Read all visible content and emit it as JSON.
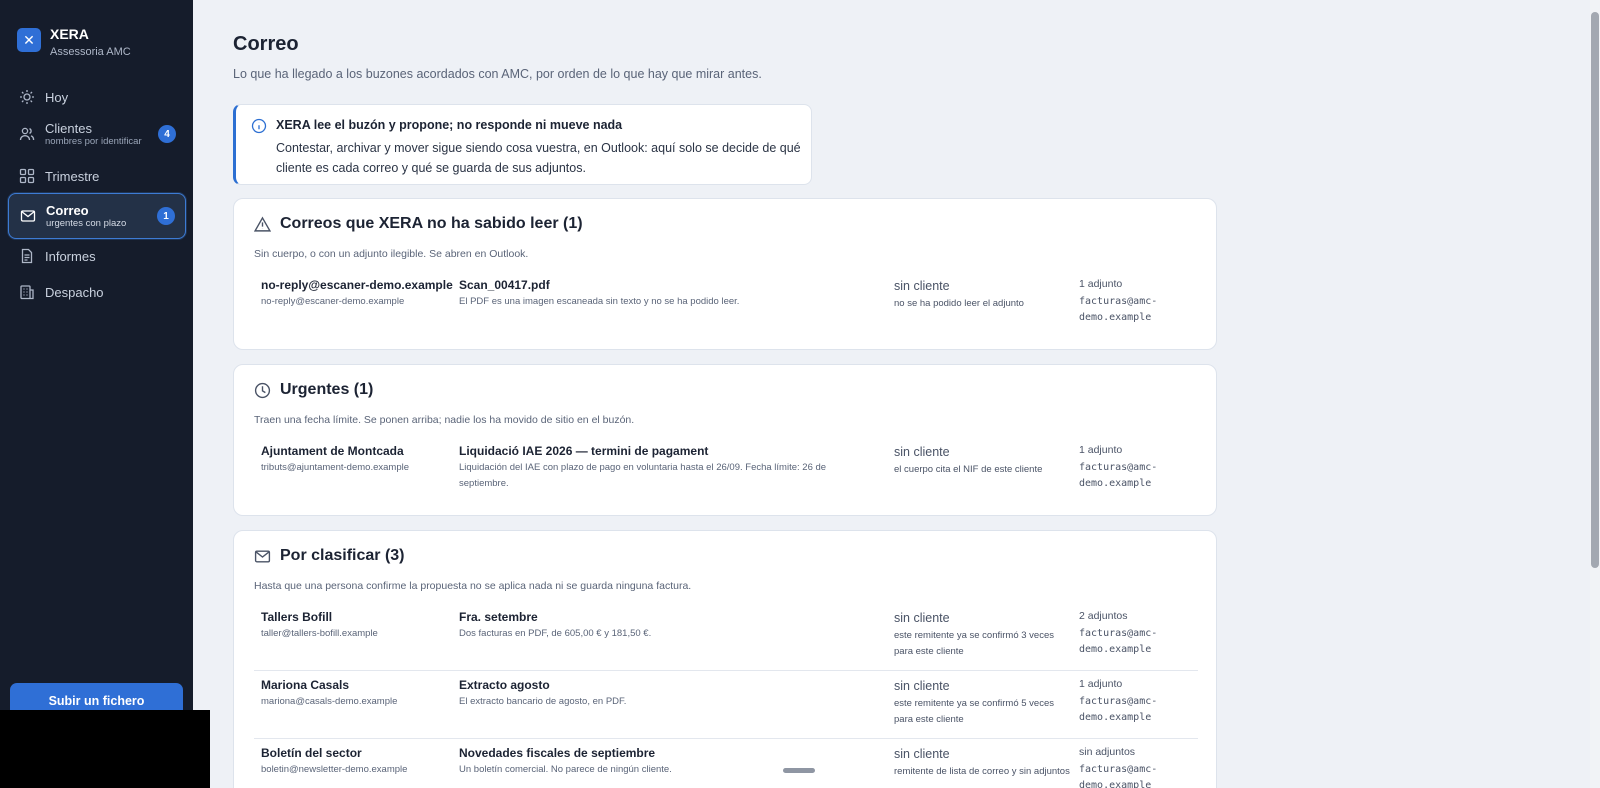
{
  "brand": {
    "name": "XERA",
    "subtitle": "Assessoria AMC",
    "logo_glyph": "✕"
  },
  "sidebar": {
    "items": [
      {
        "label": "Hoy",
        "sub": "",
        "badge": "",
        "icon": "sun-icon"
      },
      {
        "label": "Clientes",
        "sub": "nombres por identificar",
        "badge": "4",
        "icon": "users-icon"
      },
      {
        "label": "Trimestre",
        "sub": "",
        "badge": "",
        "icon": "grid-icon"
      },
      {
        "label": "Correo",
        "sub": "urgentes con plazo",
        "badge": "1",
        "icon": "mail-icon",
        "active": true
      },
      {
        "label": "Informes",
        "sub": "",
        "badge": "",
        "icon": "document-icon"
      },
      {
        "label": "Despacho",
        "sub": "",
        "badge": "",
        "icon": "building-icon"
      }
    ],
    "upload_label": "Subir un fichero"
  },
  "page": {
    "title": "Correo",
    "subtitle": "Lo que ha llegado a los buzones acordados con AMC, por orden de lo que hay que mirar antes."
  },
  "notice": {
    "title": "XERA lee el buzón y propone; no responde ni mueve nada",
    "body": "Contestar, archivar y mover sigue siendo cosa vuestra, en Outlook: aquí solo se decide de qué cliente es cada correo y qué se guarda de sus adjuntos."
  },
  "sections": [
    {
      "title": "Correos que XERA no ha sabido leer (1)",
      "subtitle": "Sin cuerpo, o con un adjunto ilegible. Se abren en Outlook.",
      "icon": "warning-icon",
      "rows": [
        {
          "from_name": "no-reply@escaner-demo.example",
          "from_email": "no-reply@escaner-demo.example",
          "subject": "Scan_00417.pdf",
          "description": "El PDF es una imagen escaneada sin texto y no se ha podido leer.",
          "client": "sin cliente",
          "reason": "no se ha podido leer el adjunto",
          "attachments": "1 adjunto",
          "mailbox_1": "facturas@amc-",
          "mailbox_2": "demo.example"
        }
      ]
    },
    {
      "title": "Urgentes (1)",
      "subtitle": "Traen una fecha límite. Se ponen arriba; nadie los ha movido de sitio en el buzón.",
      "icon": "clock-icon",
      "rows": [
        {
          "from_name": "Ajuntament de Montcada",
          "from_email": "tributs@ajuntament-demo.example",
          "subject": "Liquidació IAE 2026 — termini de pagament",
          "description": "Liquidación del IAE con plazo de pago en voluntaria hasta el 26/09. Fecha límite: 26 de septiembre.",
          "client": "sin cliente",
          "reason": "el cuerpo cita el NIF de este cliente",
          "attachments": "1 adjunto",
          "mailbox_1": "facturas@amc-",
          "mailbox_2": "demo.example"
        }
      ]
    },
    {
      "title": "Por clasificar (3)",
      "subtitle": "Hasta que una persona confirme la propuesta no se aplica nada ni se guarda ninguna factura.",
      "icon": "mail-icon",
      "rows": [
        {
          "from_name": "Tallers Bofill",
          "from_email": "taller@tallers-bofill.example",
          "subject": "Fra. setembre",
          "description": "Dos facturas en PDF, de 605,00 € y 181,50 €.",
          "client": "sin cliente",
          "reason": "este remitente ya se confirmó 3 veces para este cliente",
          "attachments": "2 adjuntos",
          "mailbox_1": "facturas@amc-",
          "mailbox_2": "demo.example"
        },
        {
          "from_name": "Mariona Casals",
          "from_email": "mariona@casals-demo.example",
          "subject": "Extracto agosto",
          "description": "El extracto bancario de agosto, en PDF.",
          "client": "sin cliente",
          "reason": "este remitente ya se confirmó 5 veces para este cliente",
          "attachments": "1 adjunto",
          "mailbox_1": "facturas@amc-",
          "mailbox_2": "demo.example"
        },
        {
          "from_name": "Boletín del sector",
          "from_email": "boletin@newsletter-demo.example",
          "subject": "Novedades fiscales de septiembre",
          "description": "Un boletín comercial. No parece de ningún cliente.",
          "client": "sin cliente",
          "reason": "remitente de lista de correo y sin adjuntos",
          "attachments": "sin adjuntos",
          "mailbox_1": "facturas@amc-",
          "mailbox_2": "demo.example"
        }
      ]
    }
  ]
}
